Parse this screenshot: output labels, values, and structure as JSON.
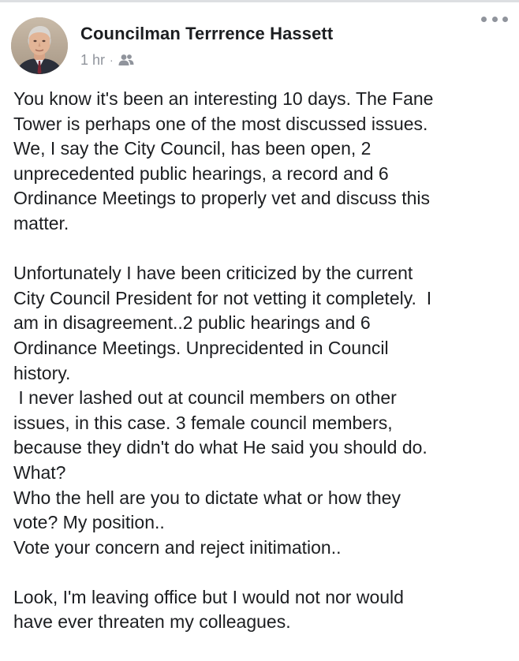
{
  "post": {
    "author": "Councilman Terrrence Hassett",
    "time": "1 hr",
    "separator": "·",
    "audience_icon": "friends-icon",
    "more_icon": "more-options-icon",
    "paragraphs": [
      [
        "You know it's been an interesting 10 days. The Fane",
        "Tower is perhaps one of the most discussed issues.",
        "We, I say the City Council, has been open, 2",
        "unprecedented public hearings, a record and 6",
        "Ordinance Meetings to properly vet and discuss this",
        "matter."
      ],
      [
        "Unfortunately I have been criticized by the current",
        "City Council President for not vetting it completely.  I",
        "am in disagreement..2 public hearings and 6",
        "Ordinance Meetings. Unprecidented in Council",
        "history.",
        " I never lashed out at council members on other",
        "issues, in this case. 3 female council members,",
        "because they didn't do what He said you should do.",
        "What?",
        "Who the hell are you to dictate what or how they",
        "vote? My position..",
        "Vote your concern and reject initimation.."
      ],
      [
        "Look, I'm leaving office but I would not nor would",
        "have ever threaten my colleagues."
      ]
    ]
  },
  "colors": {
    "text": "#1c1e21",
    "meta": "#90949c",
    "divider": "#dddfe2"
  }
}
